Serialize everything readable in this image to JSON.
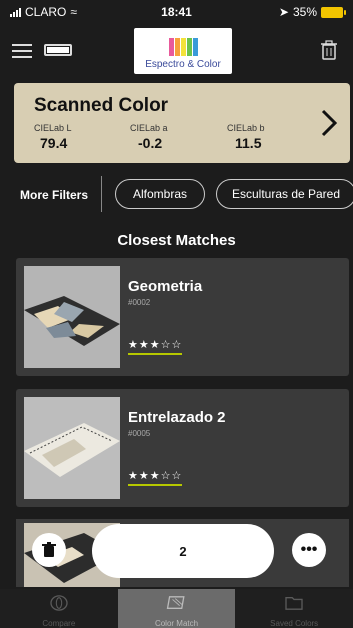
{
  "status": {
    "carrier": "CLARO",
    "time": "18:41",
    "battery": "35%"
  },
  "logo": {
    "name": "Espectro & Color"
  },
  "scanned": {
    "title": "Scanned Color",
    "values": [
      {
        "label": "CIELab L",
        "value": "79.4"
      },
      {
        "label": "CIELab a",
        "value": "-0.2"
      },
      {
        "label": "CIELab b",
        "value": "11.5"
      }
    ]
  },
  "filters": {
    "label": "More Filters",
    "chips": [
      "Alfombras",
      "Esculturas de Pared"
    ]
  },
  "matches": {
    "title": "Closest Matches",
    "items": [
      {
        "name": "Geometria",
        "code": "#0002",
        "stars": "★★★☆☆"
      },
      {
        "name": "Entrelazado 2",
        "code": "#0005",
        "stars": "★★★☆☆"
      }
    ]
  },
  "actions": {
    "count": "2"
  },
  "tabs": [
    {
      "label": "Compare",
      "icon": "compare-icon"
    },
    {
      "label": "Color Match",
      "icon": "color-match-icon"
    },
    {
      "label": "Saved Colors",
      "icon": "folder-icon"
    }
  ],
  "colors": {
    "accent": "#b6c800",
    "scan_bg": "#d8ceb3",
    "card_bg": "#3a3a3a"
  }
}
